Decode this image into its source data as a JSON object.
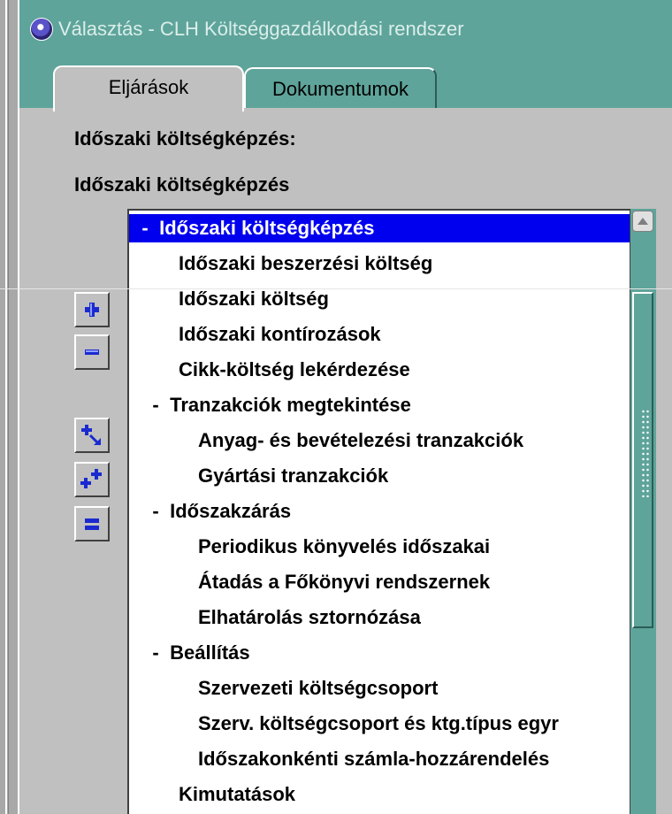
{
  "window": {
    "title": "Választás - CLH Költséggazdálkodási rendszer"
  },
  "tabs": [
    {
      "label": "Eljárások",
      "active": true
    },
    {
      "label": "Dokumentumok",
      "active": false
    }
  ],
  "labels": {
    "heading": "Időszaki költségképzés:",
    "subheading": "Időszaki költségképzés"
  },
  "tree": {
    "nodes": [
      {
        "label": "Időszaki költségképzés",
        "level": 0,
        "marker": "-",
        "selected": true
      },
      {
        "label": "Időszaki beszerzési költség",
        "level": 1,
        "marker": "",
        "selected": false
      },
      {
        "label": "Időszaki költség",
        "level": 1,
        "marker": "",
        "selected": false
      },
      {
        "label": "Időszaki kontírozások",
        "level": 1,
        "marker": "",
        "selected": false
      },
      {
        "label": "Cikk-költség lekérdezése",
        "level": 1,
        "marker": "",
        "selected": false
      },
      {
        "label": "Tranzakciók megtekintése",
        "level": 1,
        "marker": "-",
        "selected": false
      },
      {
        "label": "Anyag- és bevételezési tranzakciók",
        "level": 2,
        "marker": "",
        "selected": false
      },
      {
        "label": "Gyártási tranzakciók",
        "level": 2,
        "marker": "",
        "selected": false
      },
      {
        "label": "Időszakzárás",
        "level": 1,
        "marker": "-",
        "selected": false
      },
      {
        "label": "Periodikus könyvelés időszakai",
        "level": 2,
        "marker": "",
        "selected": false
      },
      {
        "label": "Átadás a Főkönyvi rendszernek",
        "level": 2,
        "marker": "",
        "selected": false
      },
      {
        "label": "Elhatárolás sztornózása",
        "level": 2,
        "marker": "",
        "selected": false
      },
      {
        "label": "Beállítás",
        "level": 1,
        "marker": "-",
        "selected": false
      },
      {
        "label": "Szervezeti költségcsoport",
        "level": 2,
        "marker": "",
        "selected": false
      },
      {
        "label": "Szerv. költségcsoport és ktg.típus egyr",
        "level": 2,
        "marker": "",
        "selected": false
      },
      {
        "label": "Időszakonkénti számla-hozzárendelés",
        "level": 2,
        "marker": "",
        "selected": false
      },
      {
        "label": "Kimutatások",
        "level": 1,
        "marker": "",
        "selected": false
      }
    ]
  },
  "buttons": [
    {
      "name": "expand-button",
      "icon": "plus-icon"
    },
    {
      "name": "collapse-button",
      "icon": "minus-icon"
    },
    {
      "name": "expand-branch-button",
      "icon": "plus-arrow-icon"
    },
    {
      "name": "expand-all-button",
      "icon": "double-plus-icon"
    },
    {
      "name": "collapse-all-button",
      "icon": "double-minus-icon"
    }
  ],
  "colors": {
    "titlebar": "#5ea49a",
    "selection": "#0000ee",
    "panel": "#c0c0c0"
  }
}
